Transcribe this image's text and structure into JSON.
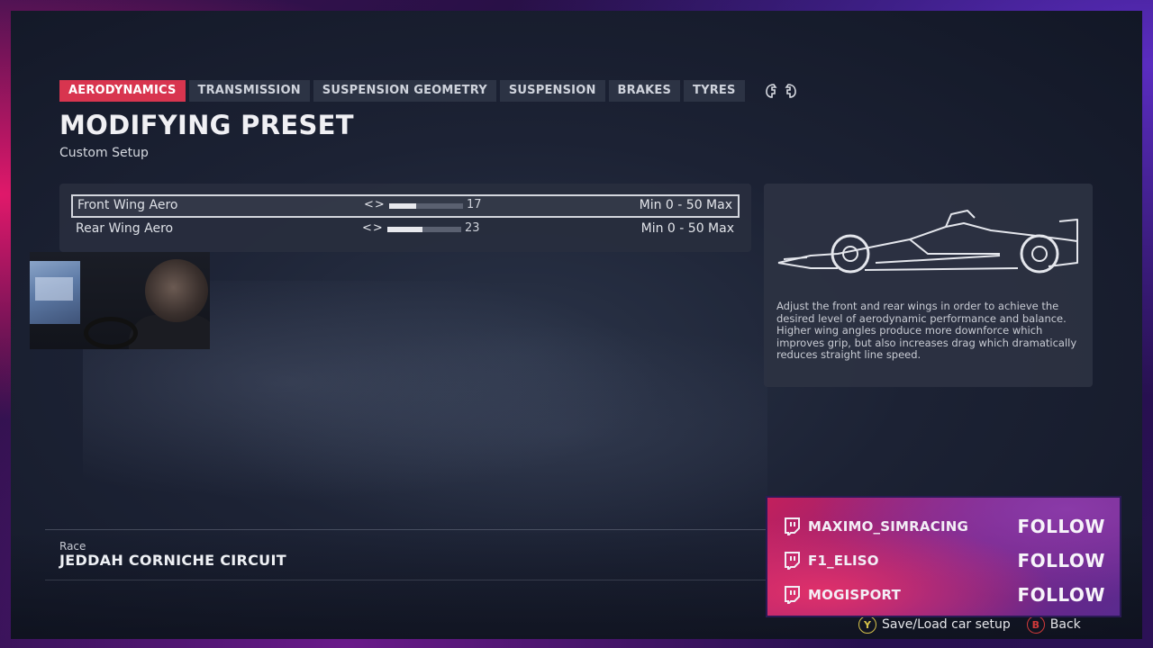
{
  "tabs": [
    {
      "label": "AERODYNAMICS",
      "active": true
    },
    {
      "label": "TRANSMISSION",
      "active": false
    },
    {
      "label": "SUSPENSION GEOMETRY",
      "active": false
    },
    {
      "label": "SUSPENSION",
      "active": false
    },
    {
      "label": "BRAKES",
      "active": false
    },
    {
      "label": "TYRES",
      "active": false
    }
  ],
  "bumper_icons": [
    "left-bumper-icon",
    "right-bumper-icon"
  ],
  "header": {
    "title": "MODIFYING PRESET",
    "subtitle": "Custom Setup"
  },
  "settings": [
    {
      "label": "Front Wing Aero",
      "value": "17",
      "fill_fraction": 0.37,
      "range": "Min 0 - 50 Max",
      "selected": true
    },
    {
      "label": "Rear Wing Aero",
      "value": "23",
      "fill_fraction": 0.47,
      "range": "Min 0 - 50 Max",
      "selected": false
    }
  ],
  "arrows_glyph": "<>",
  "info": {
    "paragraph1": "Adjust the front and rear wings in order to achieve the desired level of aerodynamic performance and balance.",
    "paragraph2": "Higher wing angles produce more downforce which improves grip, but also increases drag which dramatically reduces straight line speed."
  },
  "race": {
    "kind": "Race",
    "circuit": "JEDDAH CORNICHE CIRCUIT"
  },
  "controls": {
    "y_button": "Y",
    "save_load_label": "Save/Load car setup",
    "b_button": "B",
    "back_label": "Back"
  },
  "overlay": {
    "channels": [
      {
        "name": "MAXIMO_SIMRACING",
        "action": "FOLLOW"
      },
      {
        "name": "F1_ELISO",
        "action": "FOLLOW"
      },
      {
        "name": "MOGISPORT",
        "action": "FOLLOW"
      }
    ]
  },
  "colors": {
    "active_tab": "#d8354f",
    "panel": "#282e3e",
    "overlay_pink": "#c2205c",
    "overlay_purple": "#5a2a8e"
  }
}
